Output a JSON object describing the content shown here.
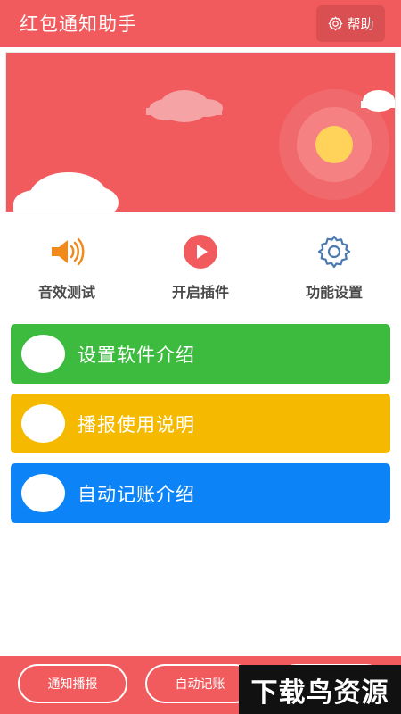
{
  "header": {
    "title": "红包通知助手",
    "help_label": "帮助"
  },
  "quick_actions": [
    {
      "label": "音效测试",
      "icon": "speaker-icon",
      "color": "#f08a1a"
    },
    {
      "label": "开启插件",
      "icon": "play-icon",
      "color": "#f25b5e"
    },
    {
      "label": "功能设置",
      "icon": "gear-icon",
      "color": "#4a7ab0"
    }
  ],
  "cards": [
    {
      "label": "设置软件介绍",
      "color": "#3dbb3f"
    },
    {
      "label": "播报使用说明",
      "color": "#f5ba00"
    },
    {
      "label": "自动记账介绍",
      "color": "#0c84f8"
    }
  ],
  "footer": {
    "tabs": [
      "通知播报",
      "自动记账",
      ""
    ]
  },
  "watermark": "下载鸟资源",
  "colors": {
    "primary": "#f25b5e",
    "sun": "#ffd25a"
  }
}
